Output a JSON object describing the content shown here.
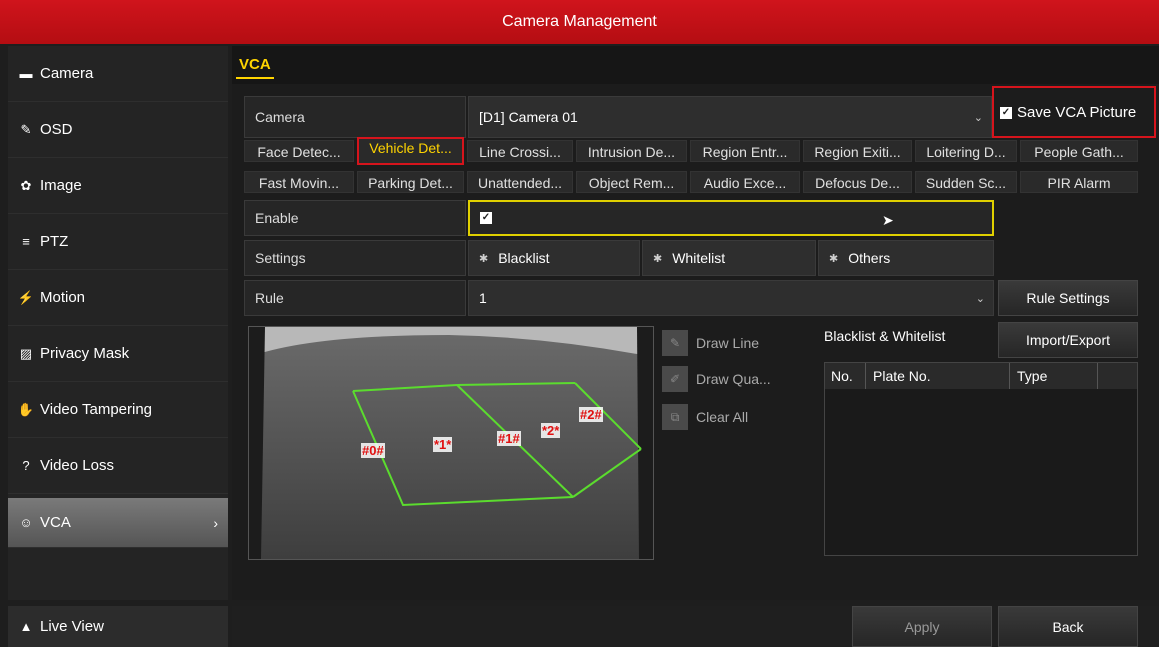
{
  "window": {
    "title": "Camera Management"
  },
  "sidebar": {
    "items": [
      {
        "label": "Camera",
        "icon": "camera-icon",
        "glyph": "▬"
      },
      {
        "label": "OSD",
        "icon": "osd-icon",
        "glyph": "✎"
      },
      {
        "label": "Image",
        "icon": "image-icon",
        "glyph": "✿"
      },
      {
        "label": "PTZ",
        "icon": "ptz-icon",
        "glyph": "≡"
      },
      {
        "label": "Motion",
        "icon": "motion-icon",
        "glyph": "⚡"
      },
      {
        "label": "Privacy Mask",
        "icon": "privacy-mask-icon",
        "glyph": "▨"
      },
      {
        "label": "Video Tampering",
        "icon": "video-tampering-icon",
        "glyph": "✋"
      },
      {
        "label": "Video Loss",
        "icon": "video-loss-icon",
        "glyph": "?"
      },
      {
        "label": "VCA",
        "icon": "vca-icon",
        "glyph": "☺",
        "active": true,
        "arrow": "›"
      }
    ],
    "live_view": {
      "label": "Live View",
      "glyph": "▲"
    }
  },
  "tabs": {
    "active": "VCA"
  },
  "form": {
    "camera_label": "Camera",
    "camera_value": "[D1] Camera 01",
    "save_vca_label": "Save VCA Picture",
    "save_vca_checked": true,
    "enable_label": "Enable",
    "enable_checked": true,
    "settings_label": "Settings",
    "settings_buttons": [
      "Blacklist",
      "Whitelist",
      "Others"
    ],
    "rule_label": "Rule",
    "rule_value": "1",
    "rule_settings_button": "Rule Settings",
    "caret": "⌄",
    "check_glyph": "✓"
  },
  "event_types": {
    "row1": [
      "Face Detec...",
      "Vehicle Det...",
      "Line Crossi...",
      "Intrusion De...",
      "Region Entr...",
      "Region Exiti...",
      "Loitering D...",
      "People Gath..."
    ],
    "row2": [
      "Fast Movin...",
      "Parking Det...",
      "Unattended...",
      "Object Rem...",
      "Audio Exce...",
      "Defocus De...",
      "Sudden Sc...",
      "PIR Alarm"
    ],
    "selected": "Vehicle Det..."
  },
  "drawing_tools": [
    "Draw Line",
    "Draw Qua...",
    "Clear All"
  ],
  "lane_labels": [
    "#0#",
    "*1*",
    "#1#",
    "*2*",
    "#2#"
  ],
  "list": {
    "title": "Blacklist & Whitelist",
    "import_export_button": "Import/Export",
    "columns": [
      "No.",
      "Plate No.",
      "Type"
    ]
  },
  "footer": {
    "apply": "Apply",
    "back": "Back"
  },
  "colors": {
    "title_red": "#c8101a",
    "accent_yellow": "#ffd400",
    "highlight_red": "#d6141c",
    "lane_green": "#5bdc2e"
  }
}
